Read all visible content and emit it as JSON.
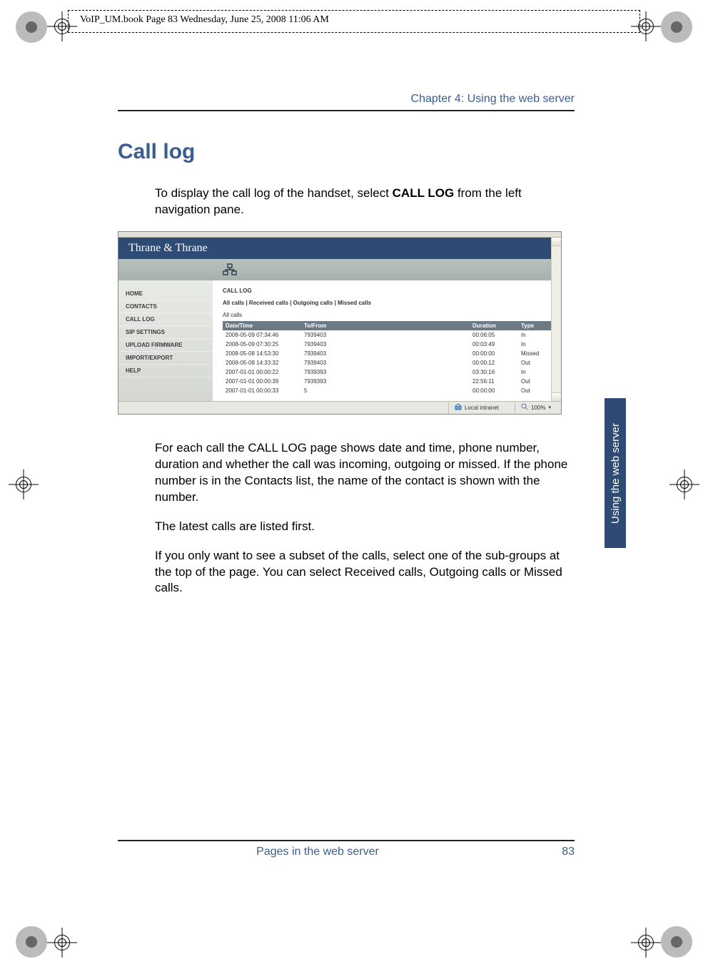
{
  "running_head": "VoIP_UM.book  Page 83  Wednesday, June 25, 2008  11:06 AM",
  "chapter_heading": "Chapter 4:  Using the web server",
  "section_title": "Call log",
  "intro_before_bold": "To display the call log of the handset, select ",
  "intro_bold": "CALL LOG",
  "intro_after_bold": " from the left navigation pane.",
  "para2": "For each call the CALL LOG page shows date and time, phone number, duration and whether the call was incoming, outgoing or missed. If the phone number is in the Contacts list, the name of the contact is shown with the number.",
  "para3": "The latest calls are listed first.",
  "para4": "If you only want to see a subset of the calls, select one of the sub-groups at the top of the page. You can select Received calls, Outgoing calls or Missed calls.",
  "side_tab": "Using the web server",
  "footer_left": "Pages in the web server",
  "footer_page": "83",
  "screenshot": {
    "brand": "Thrane & Thrane",
    "sidebar_items": [
      "HOME",
      "CONTACTS",
      "CALL LOG",
      "SIP SETTINGS",
      "UPLOAD FIRMWARE",
      "IMPORT/EXPORT",
      "HELP"
    ],
    "panel_title": "CALL LOG",
    "filters": "All calls | Received calls | Outgoing calls | Missed calls",
    "current_view": "All calls",
    "columns": [
      "Date/Time",
      "To/From",
      "Duration",
      "Type"
    ],
    "rows": [
      {
        "date": "2008-05-09 07:34:46",
        "to": "7939403",
        "dur": "00:06:05",
        "type": "In"
      },
      {
        "date": "2008-05-09 07:30:25",
        "to": "7939403",
        "dur": "00:03:49",
        "type": "In"
      },
      {
        "date": "2008-05-08 14:53:30",
        "to": "7939403",
        "dur": "00:00:00",
        "type": "Missed"
      },
      {
        "date": "2008-05-08 14:33:32",
        "to": "7939403",
        "dur": "00:00:12",
        "type": "Out"
      },
      {
        "date": "2007-01-01 00:00:22",
        "to": "7939393",
        "dur": "03:30:16",
        "type": "In"
      },
      {
        "date": "2007-01-01 00:00:39",
        "to": "7939393",
        "dur": "22:56:11",
        "type": "Out"
      },
      {
        "date": "2007-01-01 00:00:33",
        "to": "5",
        "dur": "00:00:00",
        "type": "Out"
      }
    ],
    "status_intranet": "Local intranet",
    "status_zoom": "100%"
  }
}
